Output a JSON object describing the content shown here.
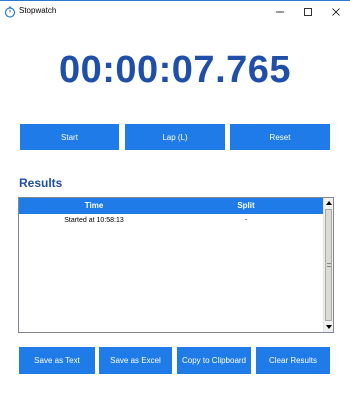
{
  "window": {
    "title": "Stopwatch",
    "icon": "stopwatch-icon",
    "accent": "#2b7bd3"
  },
  "timer": {
    "display": "00:00:07.765",
    "color": "#1f4fa8"
  },
  "controls": {
    "start_label": "Start",
    "lap_label": "Lap (L)",
    "reset_label": "Reset",
    "button_color": "#1e7be8"
  },
  "results": {
    "heading": "Results",
    "columns": [
      "Time",
      "Split"
    ],
    "rows": [
      {
        "time": "Started at 10:58:13",
        "split": "-"
      }
    ]
  },
  "actions": {
    "save_text_label": "Save as Text",
    "save_excel_label": "Save as Excel",
    "copy_label": "Copy to Clipboard",
    "clear_label": "Clear Results"
  }
}
